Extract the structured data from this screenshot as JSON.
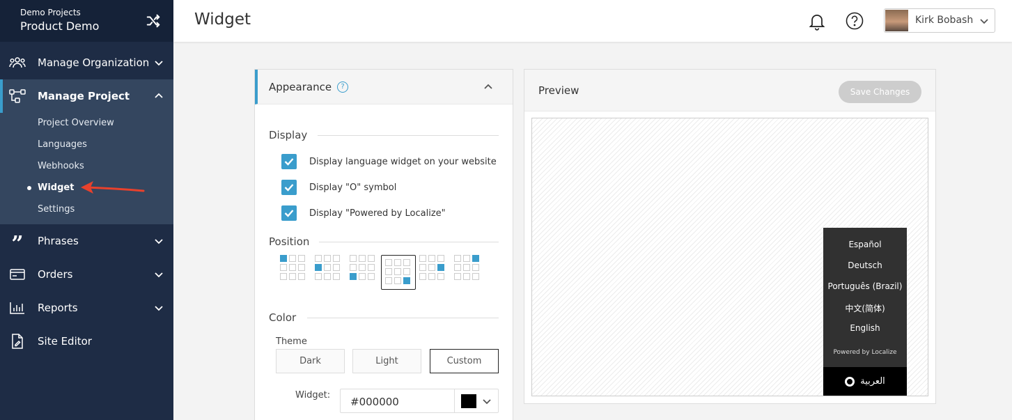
{
  "sidebar": {
    "org": "Demo Projects",
    "project": "Product Demo",
    "nav": {
      "manage_org": "Manage Organization",
      "manage_project": "Manage Project",
      "phrases": "Phrases",
      "orders": "Orders",
      "reports": "Reports",
      "site_editor": "Site Editor"
    },
    "sub": {
      "overview": "Project Overview",
      "languages": "Languages",
      "webhooks": "Webhooks",
      "widget": "Widget",
      "settings": "Settings"
    }
  },
  "header": {
    "title": "Widget",
    "user_name": "Kirk Bobash"
  },
  "appearance": {
    "title": "Appearance",
    "help_glyph": "?",
    "display_label": "Display",
    "checkboxes": [
      "Display language widget on your website",
      "Display \"O\" symbol",
      "Display \"Powered by Localize\""
    ],
    "position_label": "Position",
    "selected_position": "bottom-right",
    "color_label": "Color",
    "theme_label": "Theme",
    "themes": [
      "Dark",
      "Light",
      "Custom"
    ],
    "selected_theme": "Custom",
    "widget_label": "Widget:",
    "widget_color": "#000000"
  },
  "preview": {
    "title": "Preview",
    "save_button": "Save Changes",
    "languages": [
      "Español",
      "Deutsch",
      "Português (Brazil)",
      "中文(简体)",
      "English"
    ],
    "powered_by": "Powered by Localize",
    "current_language": "العربية"
  },
  "colors": {
    "sidebar": "#1e2c45",
    "accent": "#3a9dcc",
    "annotation_arrow": "#e8412c"
  }
}
